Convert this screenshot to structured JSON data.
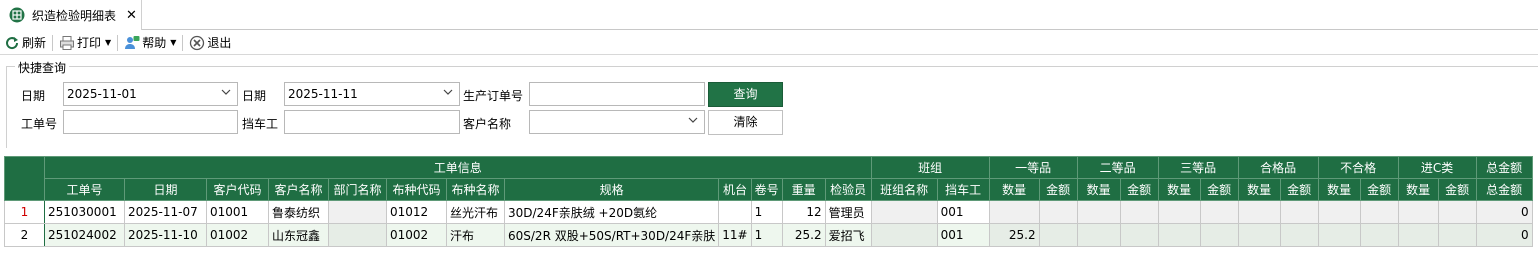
{
  "tab": {
    "title": "织造检验明细表",
    "close": "✕"
  },
  "toolbar": {
    "refresh": "刷新",
    "print": "打印",
    "help": "帮助",
    "exit": "退出"
  },
  "query": {
    "group_title": "快捷查询",
    "date_label_1": "日期",
    "date_value_1": "2025-11-01",
    "date_label_2": "日期",
    "date_value_2": "2025-11-11",
    "prod_order_label": "生产订单号",
    "prod_order_value": "",
    "query_button": "查询",
    "work_order_label": "工单号",
    "work_order_value": "",
    "operator_label": "挡车工",
    "operator_value": "",
    "customer_label": "客户名称",
    "customer_value": "",
    "clear_button": "清除"
  },
  "grid": {
    "group_headers": {
      "work_info": "工单信息",
      "shift": "班组",
      "first": "一等品",
      "second": "二等品",
      "third": "三等品",
      "qualified": "合格品",
      "unqualified": "不合格",
      "c_class": "进C类",
      "total": "总金额"
    },
    "columns": {
      "work_order": "工单号",
      "date": "日期",
      "cust_code": "客户代码",
      "cust_name": "客户名称",
      "dept": "部门名称",
      "fabric_code": "布种代码",
      "fabric_name": "布种名称",
      "spec": "规格",
      "machine": "机台",
      "roll": "卷号",
      "weight": "重量",
      "inspector": "检验员",
      "shift_name": "班组名称",
      "operator": "挡车工",
      "qty": "数量",
      "amount": "金额",
      "total": "总金额"
    },
    "rows": [
      {
        "no": "1",
        "work_order": "251030001",
        "date": "2025-11-07",
        "cust_code": "01001",
        "cust_name": "鲁泰纺织",
        "dept": "",
        "fabric_code": "01012",
        "fabric_name": "丝光汗布",
        "spec": "30D/24F亲肤绒 +20D氨纶",
        "machine": "",
        "roll": "1",
        "weight": "12",
        "inspector": "管理员",
        "shift_name": "",
        "operator": "001",
        "first_qty": "",
        "total": "0"
      },
      {
        "no": "2",
        "work_order": "251024002",
        "date": "2025-11-10",
        "cust_code": "01002",
        "cust_name": "山东冠鑫",
        "dept": "",
        "fabric_code": "01002",
        "fabric_name": "汗布",
        "spec": "60S/2R 双股+50S/RT+30D/24F亲肤",
        "machine": "11#",
        "roll": "1",
        "weight": "25.2",
        "inspector": "爱招飞",
        "shift_name": "",
        "operator": "001",
        "first_qty": "25.2",
        "total": "0"
      }
    ]
  },
  "colors": {
    "accent": "#217346",
    "header": "#1f6e43",
    "row_alt": "#eef7ee",
    "row_marker": "#d00000"
  }
}
